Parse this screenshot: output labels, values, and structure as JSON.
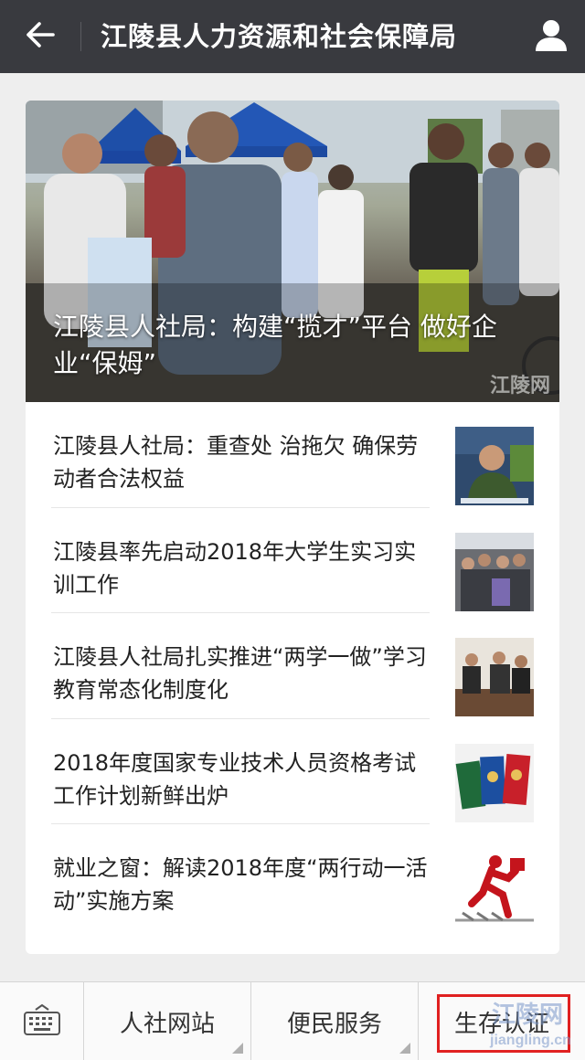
{
  "header": {
    "title": "江陵县人力资源和社会保障局",
    "back_icon": "back-arrow-icon",
    "user_icon": "user-profile-icon"
  },
  "hero": {
    "title": "江陵县人社局：构建“揽才”平台 做好企业“保姆”",
    "watermark": "江陵网"
  },
  "news": [
    {
      "title": "江陵县人社局：重查处 治拖欠 确保劳动者合法权益",
      "thumb": "official-portrait"
    },
    {
      "title": "江陵县率先启动2018年大学生实习实训工作",
      "thumb": "students-group"
    },
    {
      "title": "江陵县人社局扎实推进“两学一做”学习教育常态化制度化",
      "thumb": "meeting-room"
    },
    {
      "title": "2018年度国家专业技术人员资格考试工作计划新鲜出炉",
      "thumb": "certificates"
    },
    {
      "title": "就业之窗：解读2018年度“两行动一活动”实施方案",
      "thumb": "running-figure"
    }
  ],
  "bottom_menu": {
    "keyboard_icon": "keyboard-icon",
    "items": [
      {
        "label": "人社网站"
      },
      {
        "label": "便民服务"
      },
      {
        "label": "生存认证"
      }
    ]
  },
  "watermark": {
    "line1": "江陵网",
    "line2": "jiangling.cn"
  },
  "colors": {
    "header_bg": "#393a3f",
    "page_bg": "#eeeeee",
    "highlight": "#e02020"
  }
}
